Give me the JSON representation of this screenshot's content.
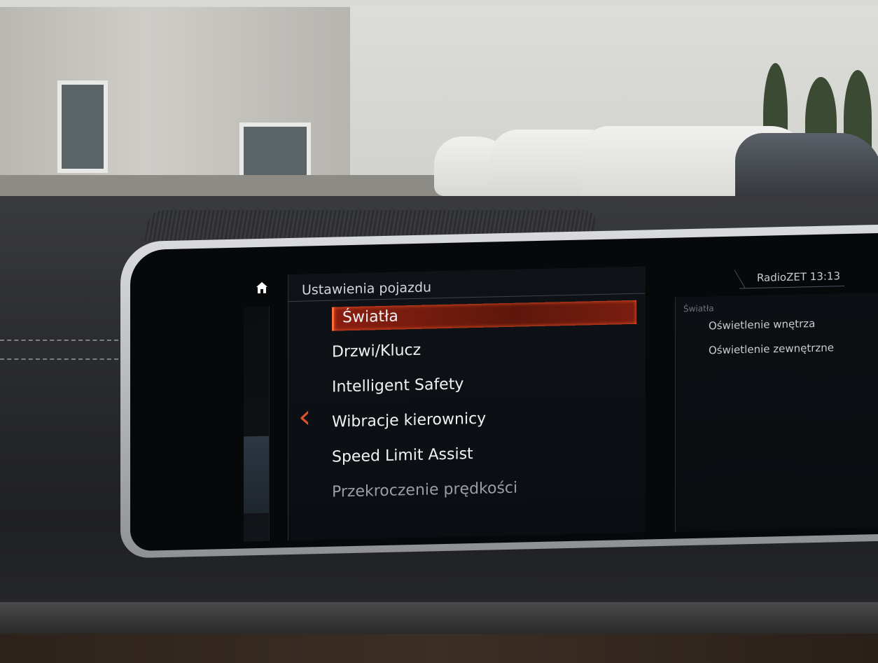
{
  "header": {
    "title": "Ustawienia pojazdu",
    "status": "RadioZET 13:13"
  },
  "menu": {
    "items": [
      {
        "label": "Światła",
        "selected": true
      },
      {
        "label": "Drzwi/Klucz"
      },
      {
        "label": "Intelligent Safety"
      },
      {
        "label": "Wibracje kierownicy"
      },
      {
        "label": "Speed Limit Assist"
      },
      {
        "label": "Przekroczenie prędkości",
        "dimmed": true
      }
    ]
  },
  "preview": {
    "title": "Światła",
    "items": [
      "Oświetlenie wnętrza",
      "Oświetlenie zewnętrzne"
    ]
  },
  "icons": {
    "home": "home-icon",
    "back": "chevron-left-icon"
  },
  "colors": {
    "accent": "#d8532a",
    "selection": "#7a1d10",
    "screen_bg": "#07080a"
  }
}
